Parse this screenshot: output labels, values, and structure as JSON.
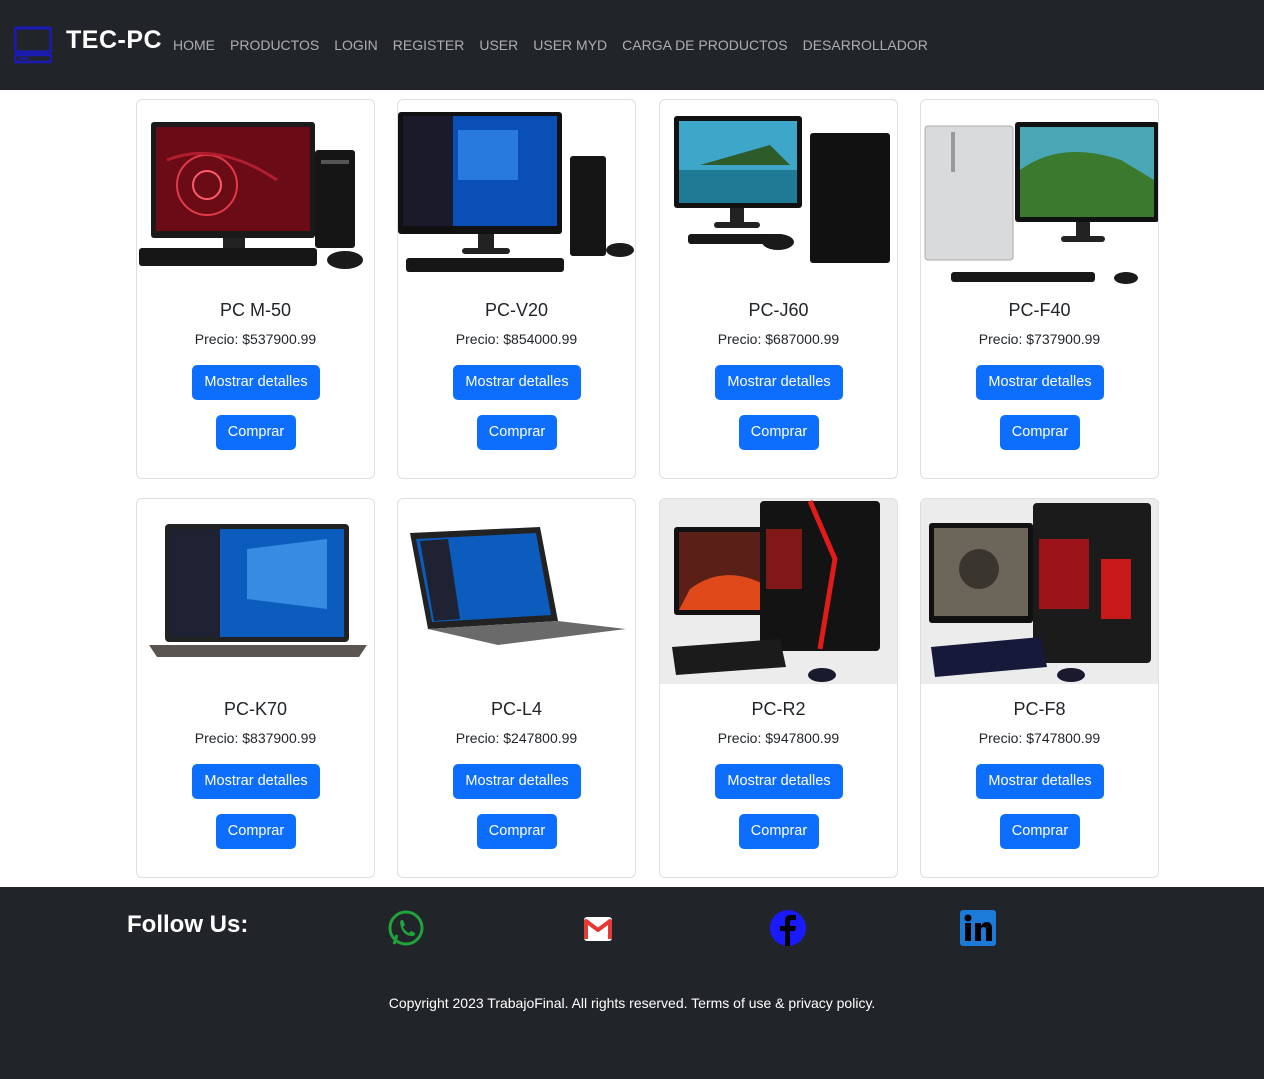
{
  "navbar": {
    "brand": "TEC-PC",
    "links": [
      "HOME",
      "PRODUCTOS",
      "LOGIN",
      "REGISTER",
      "USER",
      "USER MYD",
      "CARGA DE PRODUCTOS",
      "DESARROLLADOR"
    ]
  },
  "products": [
    {
      "name": "PC M-50",
      "price": "Precio: $537900.99",
      "details": "Mostrar detalles",
      "buy": "Comprar",
      "image": "desktop-red-wallpaper"
    },
    {
      "name": "PC-V20",
      "price": "Precio: $854000.99",
      "details": "Mostrar detalles",
      "buy": "Comprar",
      "image": "desktop-windows"
    },
    {
      "name": "PC-J60",
      "price": "Precio: $687000.99",
      "details": "Mostrar detalles",
      "buy": "Comprar",
      "image": "desktop-beach"
    },
    {
      "name": "PC-F40",
      "price": "Precio: $737900.99",
      "details": "Mostrar detalles",
      "buy": "Comprar",
      "image": "desktop-island"
    },
    {
      "name": "PC-K70",
      "price": "Precio: $837900.99",
      "details": "Mostrar detalles",
      "buy": "Comprar",
      "image": "laptop-windows"
    },
    {
      "name": "PC-L4",
      "price": "Precio: $247800.99",
      "details": "Mostrar detalles",
      "buy": "Comprar",
      "image": "laptop-angled"
    },
    {
      "name": "PC-R2",
      "price": "Precio: $947800.99",
      "details": "Mostrar detalles",
      "buy": "Comprar",
      "image": "gaming-pc-red"
    },
    {
      "name": "PC-F8",
      "price": "Precio: $747800.99",
      "details": "Mostrar detalles",
      "buy": "Comprar",
      "image": "gaming-pc-soldier"
    }
  ],
  "footer": {
    "follow": "Follow Us:",
    "social": [
      "whatsapp-icon",
      "gmail-icon",
      "facebook-icon",
      "linkedin-icon"
    ],
    "copyright": "Copyright 2023 TrabajoFinal. All rights reserved. Terms of use & privacy policy."
  },
  "colors": {
    "navbar_bg": "#212529",
    "primary": "#0d6efd",
    "whatsapp": "#1fa33a",
    "gmail": "#e53935",
    "facebook": "#1a1aff",
    "linkedin": "#1c7ad8"
  }
}
